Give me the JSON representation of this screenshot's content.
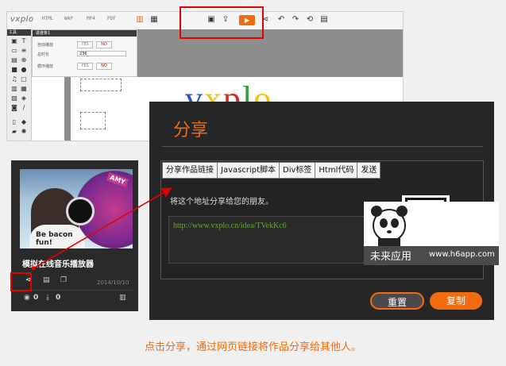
{
  "editor": {
    "logo": "vxplo",
    "formats": [
      "HTML",
      "WAP",
      "MP4",
      "PDF"
    ],
    "tools_title": "工具",
    "props": {
      "title": "进度条1",
      "rows": [
        {
          "label": "自动播放",
          "yes": "YES",
          "no": "NO"
        },
        {
          "label": "总时长",
          "value": "236"
        },
        {
          "label": "循环播放",
          "yes": "YES",
          "no": "NO"
        }
      ]
    },
    "canvas_logo": "vxplo"
  },
  "dialog": {
    "title": "分享",
    "tabs": [
      "分享作品链接",
      "Javascript脚本",
      "Div标签",
      "Html代码",
      "发送"
    ],
    "share_desc": "将这个地址分享给您的朋友。",
    "url": "http://www.vxplo.cn/idea/TVekKc6",
    "reset_label": "重置",
    "copy_label": "复制"
  },
  "watermark": {
    "app_name": "未来应用",
    "domain": "www.h6app.com"
  },
  "card": {
    "title": "模拟在线音乐播放器",
    "date": "2014/10/10",
    "views": "0",
    "downloads": "0",
    "thumb_badge": "AMY",
    "shirt_text": "Be bacon fun!"
  },
  "caption": "点击分享，通过网页链接将作品分享给其他人。",
  "colors": {
    "accent": "#f26b0e",
    "highlight": "#e60000",
    "dialog_bg": "#262626",
    "url_text": "#6aa33a"
  }
}
